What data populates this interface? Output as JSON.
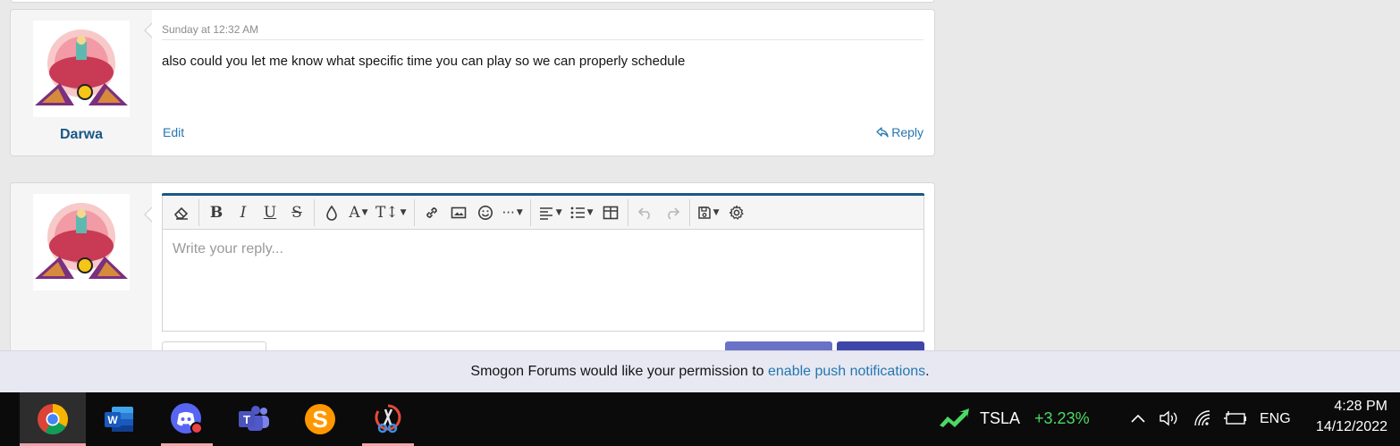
{
  "post": {
    "username": "Darwa",
    "time": "Sunday at 12:32 AM",
    "message": "also could you let me know what specific time you can play so we can properly schedule",
    "edit_label": "Edit",
    "reply_label": "Reply"
  },
  "reply_editor": {
    "placeholder": "Write your reply..."
  },
  "notification": {
    "text": "Smogon Forums would like your permission to",
    "link": "enable push notifications",
    "suffix": "."
  },
  "taskbar": {
    "apps": [
      "Google Chrome",
      "Microsoft Word",
      "Discord",
      "Microsoft Teams",
      "Sublime Text",
      "Snipping Tool"
    ],
    "stock_symbol": "TSLA",
    "stock_change": "+3.23%",
    "language": "ENG",
    "time": "4:28 PM",
    "date": "14/12/2022"
  },
  "colors": {
    "link": "#2577b1",
    "username": "#185886",
    "stock_up": "#4cd964",
    "editor_accent": "#185886"
  }
}
